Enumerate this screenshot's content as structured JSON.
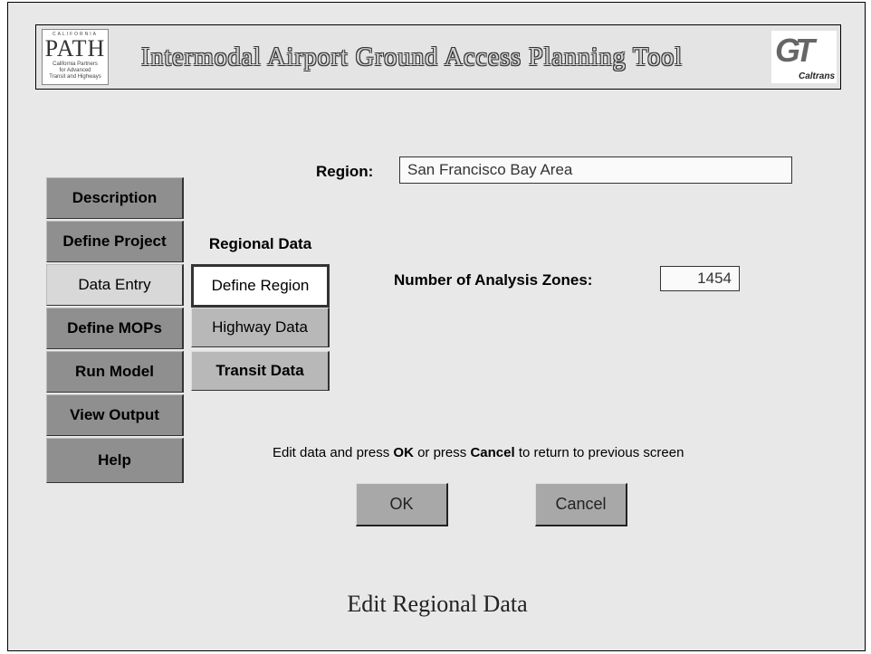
{
  "header": {
    "path_logo_main": "PATH",
    "path_logo_top": "CALIFORNIA",
    "path_logo_sub": [
      "California Partners",
      "for Advanced",
      "Transit and Highways"
    ],
    "title": "Intermodal Airport Ground Access Planning Tool",
    "caltrans_mark": "GT",
    "caltrans_label": "Caltrans"
  },
  "nav": {
    "items": [
      {
        "label": "Description"
      },
      {
        "label": "Define Project"
      },
      {
        "label": "Data Entry"
      },
      {
        "label": "Define MOPs"
      },
      {
        "label": "Run Model"
      },
      {
        "label": "View Output"
      },
      {
        "label": "Help"
      }
    ],
    "active": "Data Entry"
  },
  "subnav": {
    "heading": "Regional Data",
    "items": [
      {
        "label": "Define Region"
      },
      {
        "label": "Highway Data"
      },
      {
        "label": "Transit Data"
      }
    ],
    "active": "Define Region"
  },
  "form": {
    "region_label": "Region:",
    "region_value": "San Francisco Bay Area",
    "zones_label": "Number of Analysis Zones:",
    "zones_value": "1454"
  },
  "instruction": {
    "part1": "Edit data and press ",
    "ok_word": "OK",
    "part2": " or press ",
    "cancel_word": "Cancel",
    "part3": " to return to previous screen"
  },
  "buttons": {
    "ok": "OK",
    "cancel": "Cancel"
  },
  "screen_title": "Edit Regional Data"
}
